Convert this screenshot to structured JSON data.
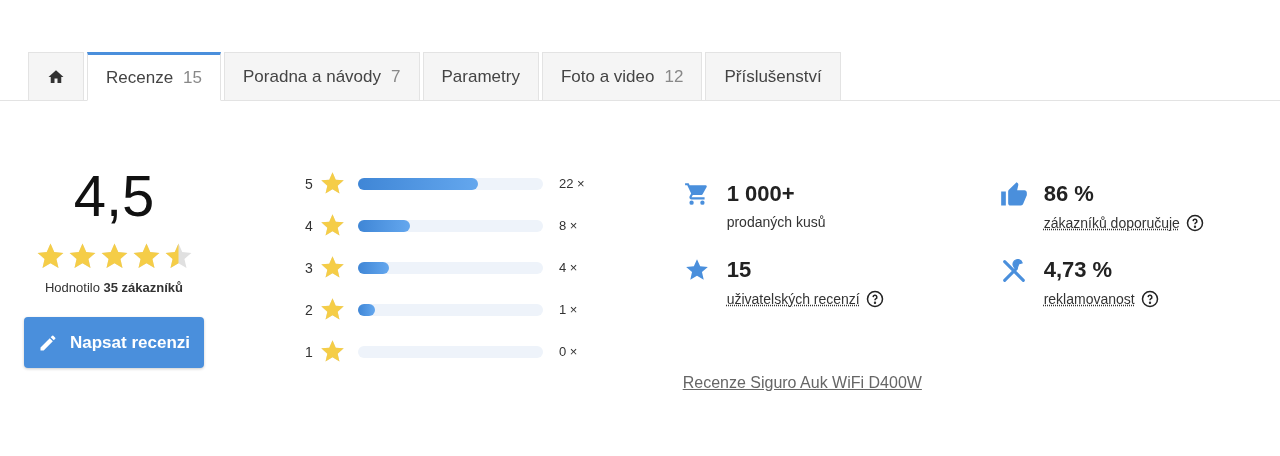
{
  "tabs": [
    {
      "kind": "home",
      "selected": false
    },
    {
      "label": "Recenze",
      "count": "15",
      "selected": true
    },
    {
      "label": "Poradna a návody",
      "count": "7",
      "selected": false
    },
    {
      "label": "Parametry",
      "selected": false
    },
    {
      "label": "Foto a video",
      "count": "12",
      "selected": false
    },
    {
      "label": "Příslušenství",
      "selected": false
    }
  ],
  "summary": {
    "score": "4,5",
    "stars": 4.5,
    "rated_by": "Hodnotilo **35 zákazníků**",
    "button": "Napsat recenzi"
  },
  "distribution": [
    {
      "rating": "5",
      "level": 0.65,
      "count": "22 ×"
    },
    {
      "rating": "4",
      "level": 0.28,
      "count": "8 ×"
    },
    {
      "rating": "3",
      "level": 0.17,
      "count": "4 ×"
    },
    {
      "rating": "2",
      "level": 0.09,
      "count": "1 ×"
    },
    {
      "rating": "1",
      "count": "0 ×"
    }
  ],
  "stats": [
    {
      "kind": "cart",
      "value": "1 000+",
      "label": "prodaných kusů",
      "help": false
    },
    {
      "kind": "thumb",
      "value": "86 %",
      "label": "zákazníků doporučuje",
      "help": true
    },
    {
      "kind": "star",
      "value": "15",
      "label": "uživatelských recenzí",
      "help": true
    },
    {
      "kind": "tools",
      "value": "4,73 %",
      "label": "reklamovanost",
      "help": true
    }
  ],
  "link": "Recenze Siguro Auk WiFi D400W"
}
